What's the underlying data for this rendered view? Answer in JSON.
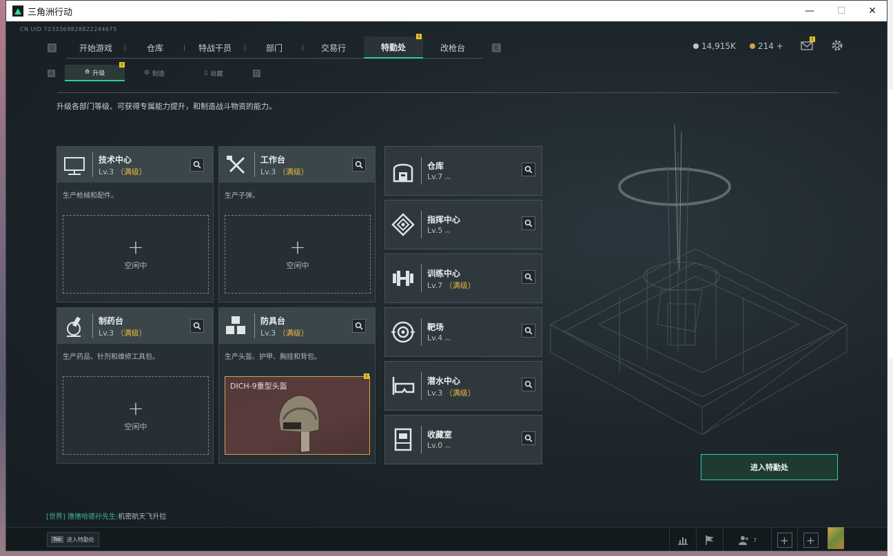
{
  "window": {
    "title": "三角洲行动",
    "minimize": "—",
    "maximize": "☐",
    "close": "✕"
  },
  "uid": "CN UID 7233369828822244675",
  "nav": {
    "left_key": "Q",
    "right_key": "E",
    "tabs": [
      "开始游戏",
      "仓库",
      "特战干员",
      "部门",
      "交易行",
      "特勤处",
      "改枪台"
    ],
    "active_index": 5,
    "badge": "!"
  },
  "currency": {
    "money": "14,915K",
    "coupons": "214 +"
  },
  "subnav": {
    "left_key": "A",
    "right_key": "D",
    "tabs": [
      "升级",
      "制造",
      "收藏"
    ],
    "badge": "!"
  },
  "description": "升级各部门等级、可获得专属能力提升，和制造战斗物资的能力。",
  "workshops": [
    {
      "name": "技术中心",
      "level": "Lv.3",
      "max": "（满级）",
      "desc": "生产枪械和配件。",
      "slot_status": "空闲中",
      "plus": "+"
    },
    {
      "name": "工作台",
      "level": "Lv.3",
      "max": "（满级）",
      "desc": "生产子弹。",
      "slot_status": "空闲中",
      "plus": "+"
    },
    {
      "name": "制药台",
      "level": "Lv.3",
      "max": "（满级）",
      "desc": "生产药品、针剂和维修工具包。",
      "slot_status": "空闲中",
      "plus": "+"
    },
    {
      "name": "防具台",
      "level": "Lv.3",
      "max": "（满级）",
      "desc": "生产头盔、护甲、胸挂和背包。",
      "item": "DICH-9重型头盔",
      "badge": "!"
    }
  ],
  "facilities": [
    {
      "name": "仓库",
      "level": "Lv.7",
      "max": "",
      "up": "︽"
    },
    {
      "name": "指挥中心",
      "level": "Lv.5",
      "max": "",
      "up": "︽"
    },
    {
      "name": "训练中心",
      "level": "Lv.7",
      "max": "（满级）",
      "up": ""
    },
    {
      "name": "靶场",
      "level": "Lv.4",
      "max": "",
      "up": "︽"
    },
    {
      "name": "潜水中心",
      "level": "Lv.3",
      "max": "（满级）",
      "up": ""
    },
    {
      "name": "收藏室",
      "level": "Lv.0",
      "max": "",
      "up": "︽"
    }
  ],
  "enter_button": "进入特勤处",
  "chat": {
    "channel": "[世界]",
    "user": "撸撸哈德孙先生:",
    "message": "机密航天飞升拉"
  },
  "bottom": {
    "tab_key": "Tab",
    "tab_label": "进入特勤处",
    "friends": "7"
  }
}
